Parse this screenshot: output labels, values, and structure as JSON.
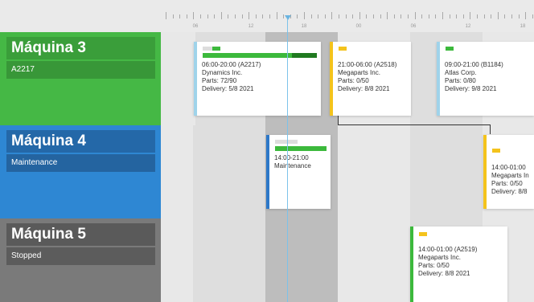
{
  "timeline": {
    "tick_labels": [
      "06",
      "12",
      "18",
      "00",
      "06",
      "12",
      "18"
    ]
  },
  "colors": {
    "accent_blue": "#6ab4e0",
    "accent_yellow": "#f4c31c",
    "accent_green": "#3cb93c",
    "accent_dark_blue": "#2d78c8",
    "progress_green": "#3cb93c",
    "progress_dark_green": "#207a20"
  },
  "machines": [
    {
      "name": "Máquina 3",
      "status": "A2217",
      "color": "#45b845",
      "title_bg": "#3a9e3a",
      "status_bg": "#389738",
      "cards": [
        {
          "line1": "06:00-20:00 (A2217)",
          "line2": "Dynamics Inc.",
          "line3": "Parts: 72/90",
          "line4": "Delivery: 5/8 2021",
          "accent": "#9fd3ea",
          "progress": 0.8
        },
        {
          "line1": "21:00-06:00 (A2518)",
          "line2": "Megaparts Inc.",
          "line3": "Parts: 0/50",
          "line4": "Delivery: 8/8 2021",
          "accent": "#f4c31c",
          "progress": 0
        },
        {
          "line1": "09:00-21:00 (B1184)",
          "line2": "Atlas Corp.",
          "line3": "Parts: 0/80",
          "line4": "Delivery: 9/8 2021",
          "accent": "#9fd3ea",
          "progress": 0
        }
      ]
    },
    {
      "name": "Máquina 4",
      "status": "Maintenance",
      "color": "#2e87d3",
      "title_bg": "#2468a8",
      "status_bg": "#2464a0",
      "cards": [
        {
          "line1": "14:00-21:00",
          "line2": "Maintenance",
          "accent": "#2d78c8",
          "progress": 1
        },
        {
          "line1": "14:00-01:00",
          "line2": "Megaparts In",
          "line3": "Parts: 0/50",
          "line4": "Delivery: 8/8",
          "accent": "#f4c31c",
          "progress": 0
        }
      ]
    },
    {
      "name": "Máquina 5",
      "status": "Stopped",
      "color": "#7a7a7a",
      "title_bg": "#5a5a5a",
      "status_bg": "#5c5c5c",
      "cards": [
        {
          "line1": "14:00-01:00 (A2519)",
          "line2": "Megaparts Inc.",
          "line3": "Parts: 0/50",
          "line4": "Delivery: 8/8 2021",
          "accent": "#3cb93c",
          "progress": 0
        }
      ]
    }
  ]
}
